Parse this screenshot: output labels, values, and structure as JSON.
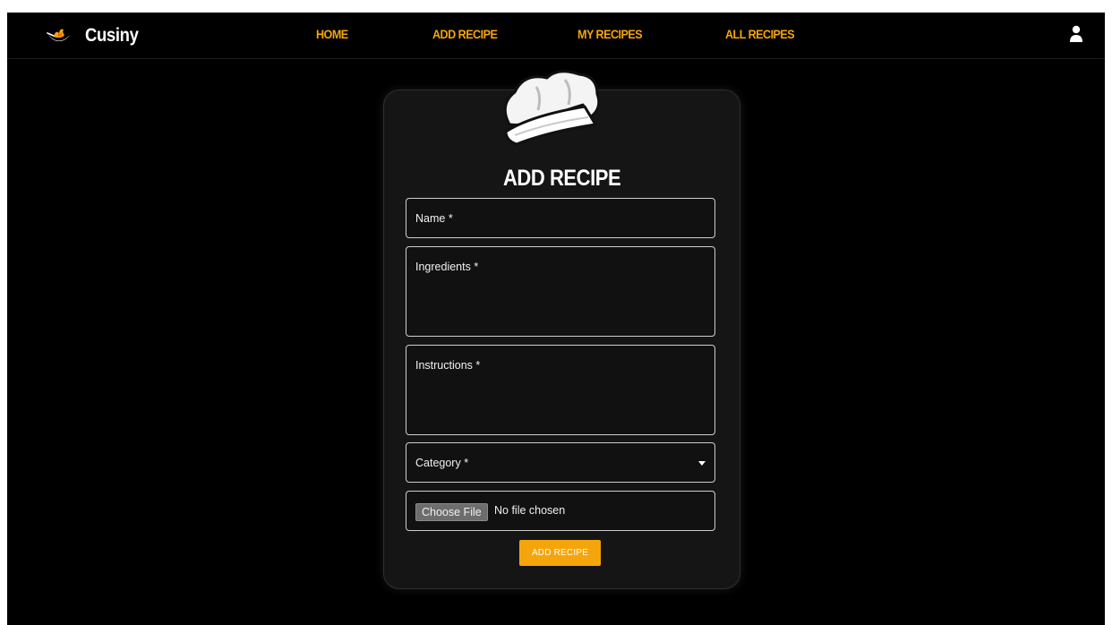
{
  "brand": {
    "name": "Cusiny",
    "logo_icon": "flame-bowl-icon"
  },
  "nav": {
    "links": [
      {
        "label": "HOME"
      },
      {
        "label": "ADD RECIPE"
      },
      {
        "label": "MY RECIPES"
      },
      {
        "label": "ALL RECIPES"
      }
    ],
    "user_icon": "user-icon"
  },
  "form": {
    "icon": "chef-hat-icon",
    "title": "ADD RECIPE",
    "fields": {
      "name": {
        "label": "Name *",
        "value": ""
      },
      "ingredients": {
        "label": "Ingredients *",
        "value": ""
      },
      "instructions": {
        "label": "Instructions *",
        "value": ""
      },
      "category": {
        "label": "Category *",
        "value": ""
      }
    },
    "file": {
      "button_label": "Choose File",
      "status": "No file chosen"
    },
    "submit_label": "ADD RECIPE"
  },
  "colors": {
    "accent": "#f5a50c",
    "background": "#000000",
    "card": "#151515",
    "text": "#ffffff"
  }
}
